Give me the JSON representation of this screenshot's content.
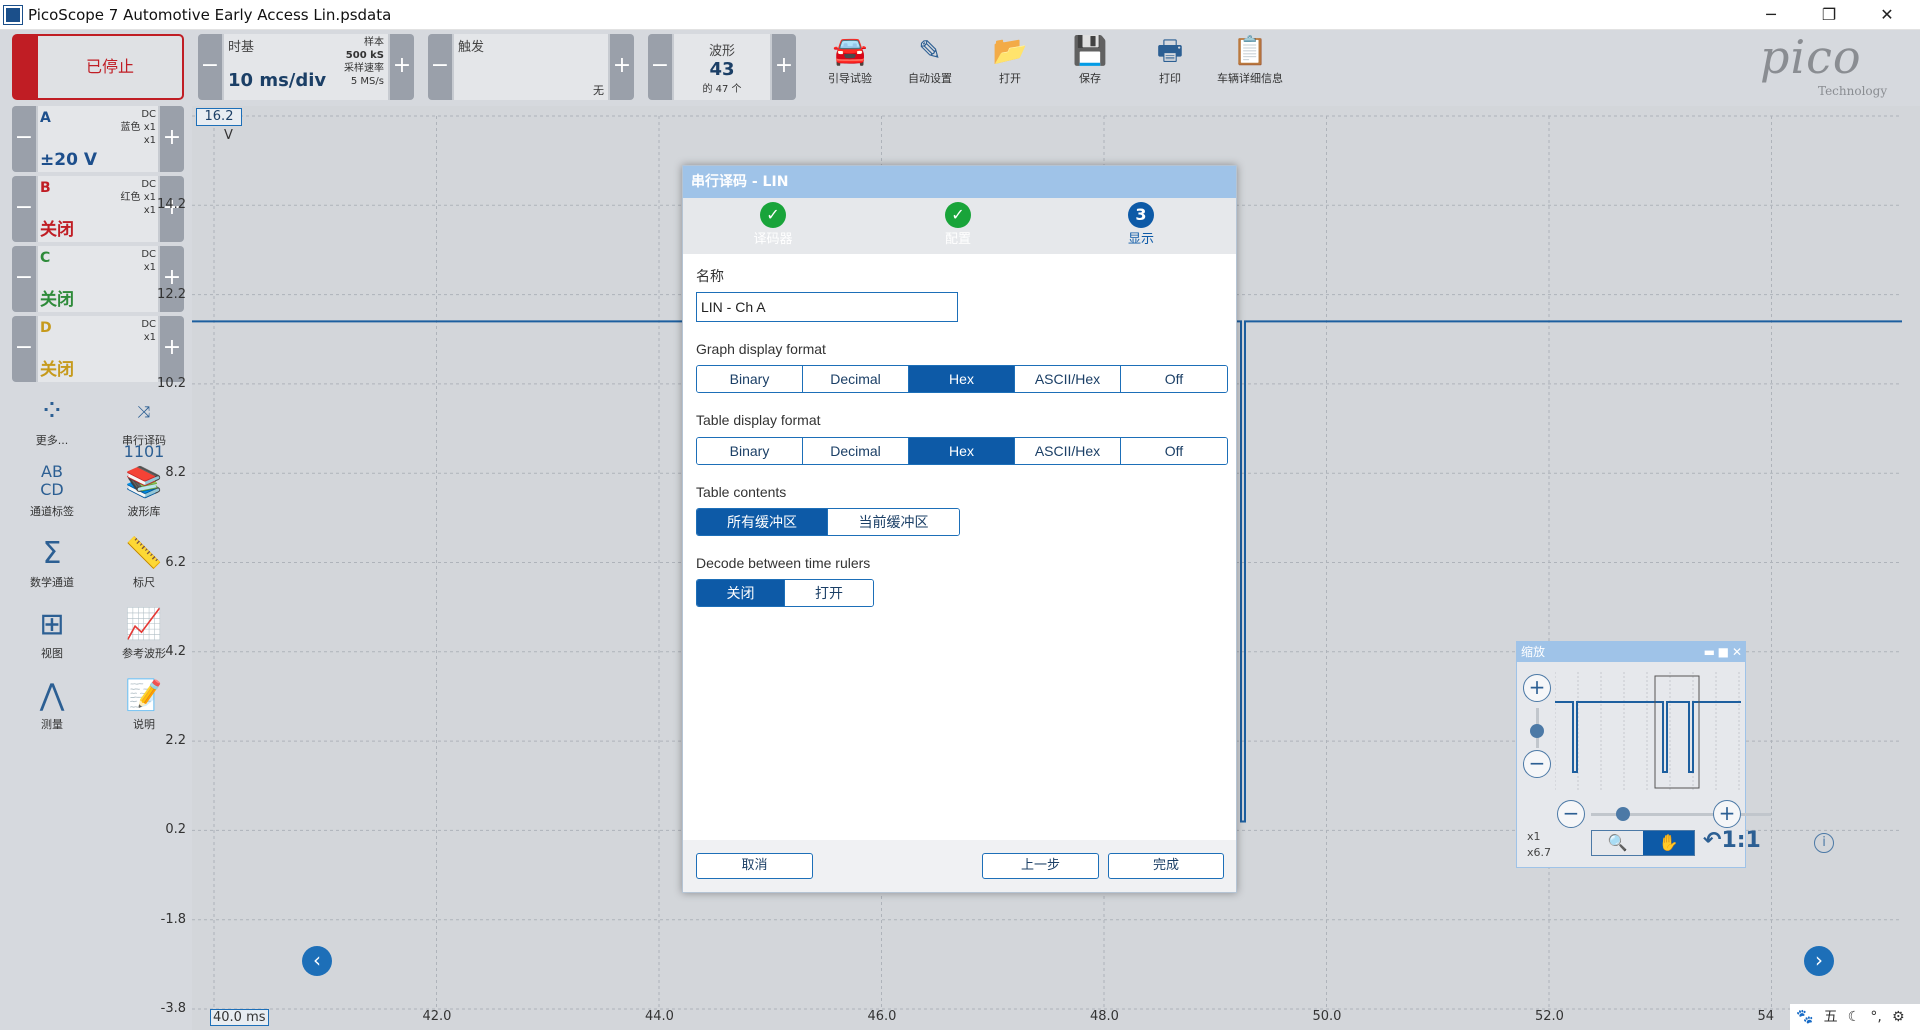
{
  "window": {
    "title": "PicoScope 7 Automotive Early Access Lin.psdata",
    "minimize": "─",
    "maximize": "❐",
    "close": "✕"
  },
  "toolbar": {
    "stop_label": "已停止",
    "timebase": {
      "title": "时基",
      "value": "10 ms/div",
      "samples_label": "样本",
      "samples_value": "500 kS",
      "rate_label": "采样速率",
      "rate_value": "5 MS/s"
    },
    "trigger": {
      "title": "触发",
      "mode": "无"
    },
    "waveform": {
      "title": "波形",
      "value": "43",
      "of_total": "的 47 个"
    },
    "tools": [
      {
        "label": "引导试验",
        "icon": "car-icon"
      },
      {
        "label": "自动设置",
        "icon": "wand-icon"
      },
      {
        "label": "打开",
        "icon": "folder-icon"
      },
      {
        "label": "保存",
        "icon": "save-icon"
      },
      {
        "label": "打印",
        "icon": "print-icon"
      },
      {
        "label": "车辆详细信息",
        "icon": "clipboard-icon"
      }
    ],
    "logo": "pico",
    "logo_sub": "Technology"
  },
  "channels": [
    {
      "letter": "A",
      "coupling": "DC",
      "probe": "蓝色 x1",
      "mult": "x1",
      "range": "±20 V",
      "color": "#1d4f8c"
    },
    {
      "letter": "B",
      "coupling": "DC",
      "probe": "红色 x1",
      "mult": "x1",
      "range": "关闭",
      "color": "#c01d24"
    },
    {
      "letter": "C",
      "coupling": "DC",
      "probe": "x1",
      "mult": "",
      "range": "关闭",
      "color": "#2e8b3a"
    },
    {
      "letter": "D",
      "coupling": "DC",
      "probe": "x1",
      "mult": "",
      "range": "关闭",
      "color": "#c69a1c"
    }
  ],
  "side_tools": [
    {
      "label": "更多...",
      "icon": "grid-dots-icon"
    },
    {
      "label": "串行译码",
      "icon": "serial-decode-icon"
    },
    {
      "label": "通道标签",
      "icon": "channel-labels-icon"
    },
    {
      "label": "波形库",
      "icon": "waveform-library-icon"
    },
    {
      "label": "数学通道",
      "icon": "sigma-icon"
    },
    {
      "label": "标尺",
      "icon": "ruler-icon"
    },
    {
      "label": "视图",
      "icon": "view-grid-icon"
    },
    {
      "label": "参考波形",
      "icon": "reference-waveform-icon"
    },
    {
      "label": "测量",
      "icon": "measure-icon"
    },
    {
      "label": "说明",
      "icon": "notes-icon"
    }
  ],
  "graph": {
    "y_unit": "V",
    "y_ticks": [
      "16.2",
      "14.2",
      "12.2",
      "10.2",
      "8.2",
      "6.2",
      "4.2",
      "2.2",
      "0.2",
      "-1.8",
      "-3.8"
    ],
    "x_ticks": [
      "40.0 ms",
      "42.0",
      "44.0",
      "46.0",
      "48.0",
      "50.0",
      "52.0",
      "54"
    ],
    "trace_high_v": 11.6,
    "trace_low_v": 0.4
  },
  "dialog": {
    "title": "串行译码 - LIN",
    "steps": [
      {
        "label": "译码器",
        "state": "done",
        "mark": "✓"
      },
      {
        "label": "配置",
        "state": "done",
        "mark": "✓"
      },
      {
        "label": "显示",
        "state": "current",
        "mark": "3"
      }
    ],
    "name_label": "名称",
    "name_value": "LIN - Ch A",
    "graph_format_label": "Graph display format",
    "table_format_label": "Table display format",
    "format_options": [
      "Binary",
      "Decimal",
      "Hex",
      "ASCII/Hex",
      "Off"
    ],
    "format_selected": "Hex",
    "table_contents_label": "Table contents",
    "table_contents_options": [
      "所有缓冲区",
      "当前缓冲区"
    ],
    "decode_rulers_label": "Decode between time rulers",
    "decode_rulers_options": [
      "关闭",
      "打开"
    ],
    "cancel": "取消",
    "back": "上一步",
    "finish": "完成"
  },
  "zoom": {
    "title": "缩放",
    "x1": "x1",
    "x67": "x6.7",
    "ratio": "1:1"
  },
  "tray": [
    "🐾",
    "五",
    "☾",
    "°,",
    "⚙"
  ]
}
